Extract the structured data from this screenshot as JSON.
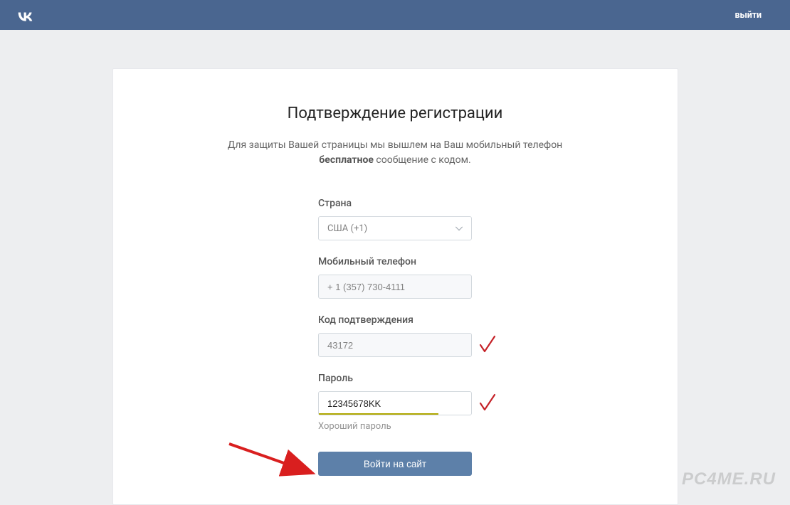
{
  "header": {
    "logout_label": "выйти"
  },
  "page": {
    "title": "Подтверждение регистрации",
    "subtitle_before": "Для защиты Вашей страницы мы вышлем на Ваш мобильный телефон ",
    "subtitle_bold": "бесплатное",
    "subtitle_after": " сообщение с кодом."
  },
  "form": {
    "country": {
      "label": "Страна",
      "selected": "США (+1)"
    },
    "phone": {
      "label": "Мобильный телефон",
      "value": "+ 1 (357) 730-4111"
    },
    "code": {
      "label": "Код подтверждения",
      "value": "43172"
    },
    "password": {
      "label": "Пароль",
      "value": "12345678KK",
      "hint": "Хороший пароль"
    },
    "submit_label": "Войти на сайт"
  },
  "watermark": "PC4ME.RU"
}
